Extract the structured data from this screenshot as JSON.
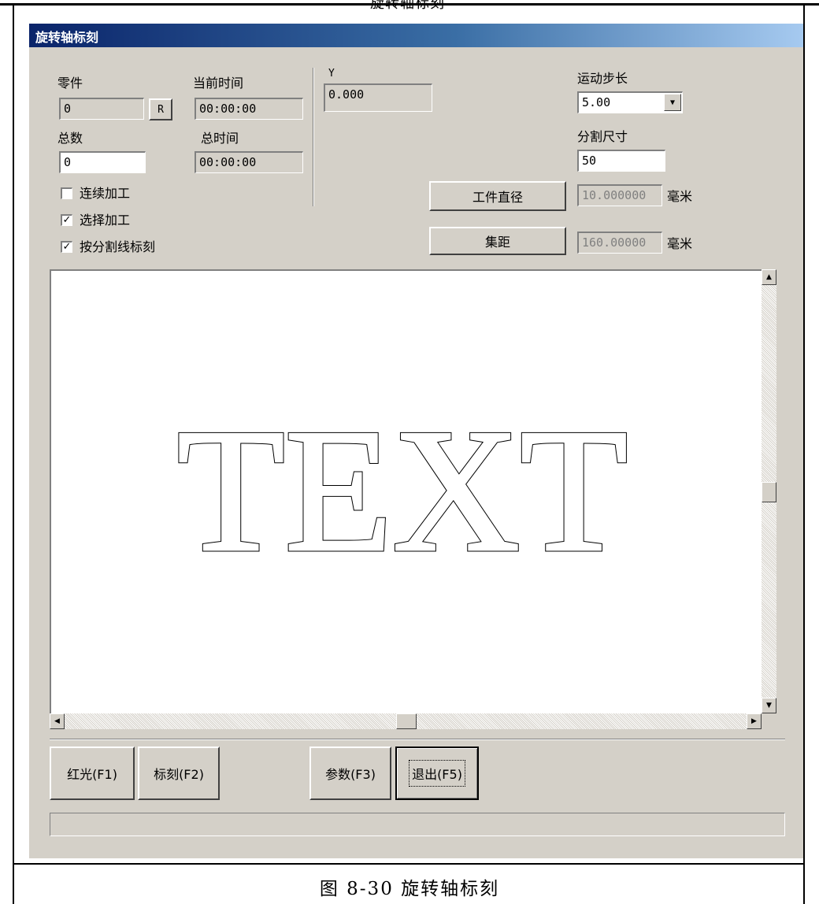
{
  "document": {
    "header": "旋转轴标刻",
    "caption": "图 8-30 旋转轴标刻"
  },
  "window": {
    "title": "旋转轴标刻"
  },
  "part": {
    "label": "零件",
    "value": "0",
    "reset_label": "R"
  },
  "current_time": {
    "label": "当前时间",
    "value": "00:00:00"
  },
  "total": {
    "label": "总数",
    "value": "0"
  },
  "total_time": {
    "label": "总时间",
    "value": "00:00:00"
  },
  "y_axis": {
    "label": "Y",
    "value": "0.000"
  },
  "step": {
    "label": "运动步长",
    "selected": "5.00"
  },
  "split_size": {
    "label": "分割尺寸",
    "value": "50"
  },
  "options": [
    {
      "label": "连续加工",
      "checked": false
    },
    {
      "label": "选择加工",
      "checked": true
    },
    {
      "label": "按分割线标刻",
      "checked": true
    }
  ],
  "workpiece_diameter": {
    "button_label": "工件直径",
    "value": "10.000000",
    "unit": "毫米"
  },
  "focal_distance": {
    "button_label": "集距",
    "value": "160.00000",
    "unit": "毫米"
  },
  "preview": {
    "text": "TEXT"
  },
  "buttons": {
    "red_light": "红光(F1)",
    "mark": "标刻(F2)",
    "params": "参数(F3)",
    "exit": "退出(F5)"
  },
  "icons": {
    "up": "scroll-up-arrow-icon",
    "down": "scroll-down-arrow-icon",
    "left": "scroll-left-arrow-icon",
    "right": "scroll-right-arrow-icon",
    "dropdown": "chevron-down-icon"
  },
  "colors": {
    "title_start": "#0a246a",
    "title_end": "#a6caf0",
    "face": "#d4d0c8"
  }
}
